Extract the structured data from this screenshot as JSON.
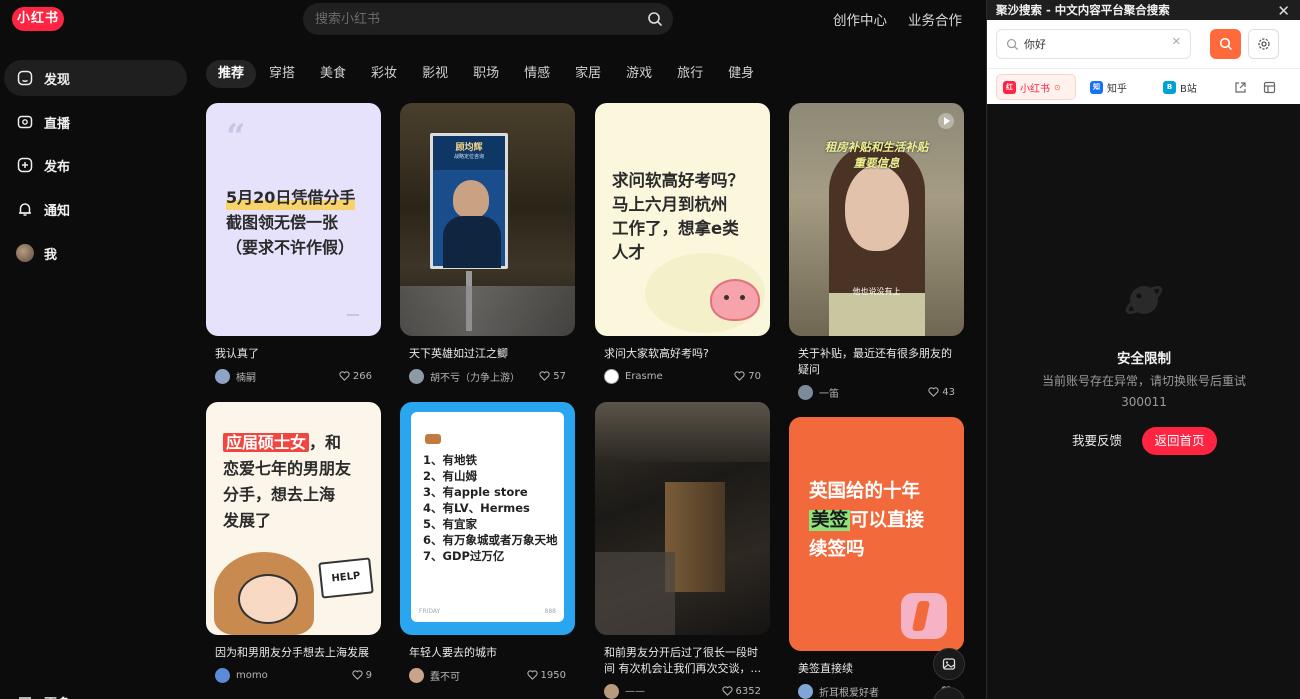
{
  "app": {
    "logo": "小红书"
  },
  "search": {
    "placeholder": "搜索小红书"
  },
  "header": {
    "links": [
      "创作中心",
      "业务合作"
    ]
  },
  "sidebar": {
    "items": [
      {
        "label": "发现",
        "icon": "home-icon",
        "active": true
      },
      {
        "label": "直播",
        "icon": "live-icon"
      },
      {
        "label": "发布",
        "icon": "plus-icon"
      },
      {
        "label": "通知",
        "icon": "bell-icon"
      },
      {
        "label": "我",
        "icon": "avatar"
      }
    ],
    "more": "更多"
  },
  "tabs": [
    "推荐",
    "穿搭",
    "美食",
    "彩妆",
    "影视",
    "职场",
    "情感",
    "家居",
    "游戏",
    "旅行",
    "健身"
  ],
  "active_tab": "推荐",
  "feed": [
    {
      "title": "我认真了",
      "author": "楠嗣",
      "likes": "266",
      "cover_text": [
        "5月20日凭借分手",
        "截图领无偿一张",
        "（要求不许作假）"
      ]
    },
    {
      "title": "天下英雄如过江之鲫",
      "author": "胡不亏（力争上游）",
      "likes": "57",
      "cover_text": [
        "顾均辉",
        "战略定位咨询"
      ]
    },
    {
      "title": "求问大家软高好考吗?",
      "author": "Erasme",
      "likes": "70",
      "cover_text": [
        "求问软高好考吗？",
        "马上六月到杭州",
        "工作了，想拿e类",
        "人才"
      ]
    },
    {
      "title": "关于补贴，最近还有很多朋友的疑问",
      "author": "一笛",
      "likes": "43",
      "cover_text": [
        "租房补贴和生活补贴",
        "重要信息",
        "他也说没有上"
      ]
    },
    {
      "title": "因为和男朋友分手想去上海发展",
      "author": "momo",
      "likes": "9",
      "cover_text": [
        "应届硕士女",
        "，和",
        "恋爱七年的男朋友",
        "分手，想去上海",
        "发展了",
        "HELP"
      ]
    },
    {
      "title": "年轻人要去的城市",
      "author": "蠢不可",
      "likes": "1950",
      "cover_text": [
        "1、有地铁",
        "2、有山姆",
        "3、有apple store",
        "4、有LV、Hermes",
        "5、有宜家",
        "6、有万象城或者万象天地",
        "7、GDP过万亿",
        "FRIDAY",
        "888"
      ]
    },
    {
      "title": "和前男友分开后过了很长一段时间 有次机会让我们再次交谈，...",
      "author": "——",
      "likes": "6352",
      "cover_text": []
    },
    {
      "title": "美签直接续",
      "author": "折耳根爱好者",
      "likes": "",
      "cover_text": [
        "英国给的十年",
        "美签",
        "可以直接",
        "续签吗"
      ]
    }
  ],
  "panel": {
    "title": "聚沙搜索 - 中文内容平台聚合搜索",
    "query": "你好",
    "sources": [
      {
        "label": "小红书",
        "badge": "红",
        "color": "#ff2442",
        "active": true
      },
      {
        "label": "知乎",
        "badge": "知",
        "color": "#1772f6"
      },
      {
        "label": "B站",
        "badge": "B",
        "color": "#00a1d6"
      }
    ],
    "error": {
      "title": "安全限制",
      "message": "当前账号存在异常，请切换账号后重试",
      "code": "300011",
      "feedback": "我要反馈",
      "home": "返回首页"
    }
  },
  "colors": {
    "brand": "#ff2442",
    "panel_button": "#ff6a3d"
  }
}
